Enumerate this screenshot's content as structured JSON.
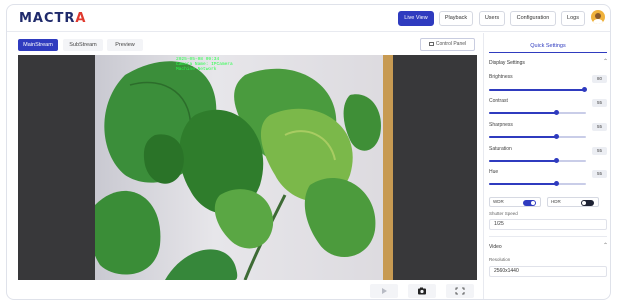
{
  "brand": {
    "logo_text_a": "MACTR",
    "logo_text_b": "A"
  },
  "nav": [
    {
      "label": "Live View",
      "active": true
    },
    {
      "label": "Playback",
      "active": false
    },
    {
      "label": "Users",
      "active": false
    },
    {
      "label": "Configuration",
      "active": false
    },
    {
      "label": "Logs",
      "active": false
    }
  ],
  "stream_tabs": [
    {
      "label": "MainStream",
      "active": true
    },
    {
      "label": "SubStream",
      "active": false
    },
    {
      "label": "Preview",
      "active": false
    }
  ],
  "control_panel_label": "Control Panel",
  "osd": {
    "line1": "2025-05-08 09:34",
    "line2": "Camera Name: IPCamera",
    "line3": "Machine Network"
  },
  "player_controls": {
    "play_icon": "play-icon",
    "snapshot_icon": "camera-icon",
    "fullscreen_icon": "fullscreen-icon"
  },
  "sidebar": {
    "tab_label": "Quick Settings",
    "display_settings": {
      "title": "Display Settings",
      "sliders": [
        {
          "label": "Brightness",
          "value": "80",
          "fraction": 0.98
        },
        {
          "label": "Contrast",
          "value": "55",
          "fraction": 0.7
        },
        {
          "label": "Sharpness",
          "value": "55",
          "fraction": 0.7
        },
        {
          "label": "Saturation",
          "value": "55",
          "fraction": 0.7
        },
        {
          "label": "Hue",
          "value": "55",
          "fraction": 0.7
        }
      ],
      "toggles": [
        {
          "label": "WDR",
          "on": true
        },
        {
          "label": "HDR",
          "on": false
        }
      ],
      "shutter_label": "Shutter Speed",
      "shutter_value": "1/25"
    },
    "video": {
      "title": "Video",
      "resolution_label": "Resolution",
      "resolution_value": "2560x1440"
    }
  },
  "colors": {
    "accent": "#2f3bbf",
    "osd_text": "#29ff4a",
    "logo_accent": "#e03a2f"
  }
}
